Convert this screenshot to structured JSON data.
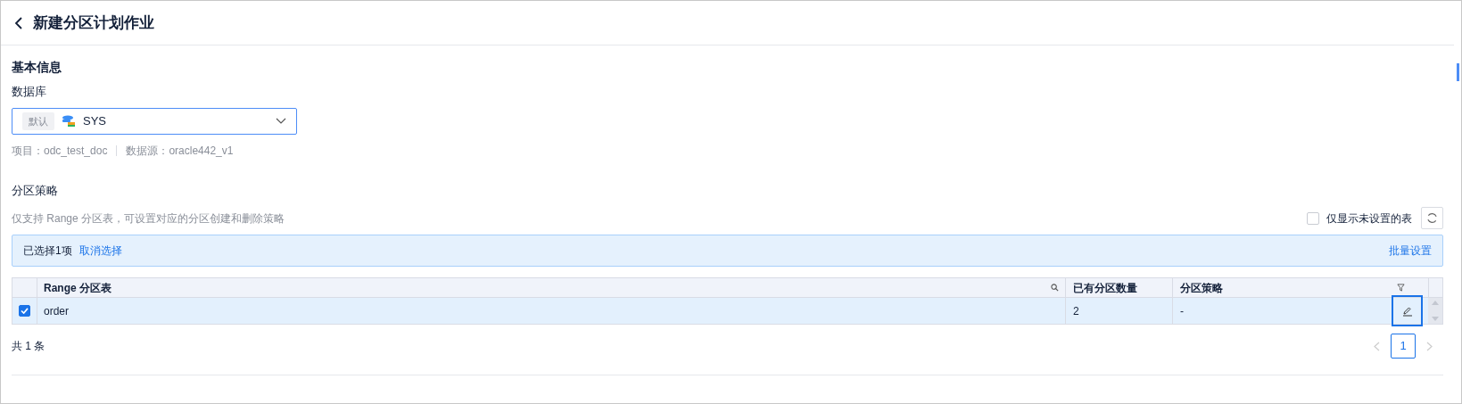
{
  "header": {
    "title": "新建分区计划作业"
  },
  "basic_info": {
    "heading": "基本信息",
    "database_label": "数据库",
    "database": {
      "tag": "默认",
      "value": "SYS"
    },
    "meta": [
      {
        "text": "项目：odc_test_doc"
      },
      {
        "text": "数据源：oracle442_v1"
      }
    ]
  },
  "partition_strategy": {
    "heading": "分区策略",
    "hint": "仅支持 Range 分区表，可设置对应的分区创建和删除策略",
    "only_unset": {
      "label": "仅显示未设置的表",
      "checked": false
    },
    "selection_bar": {
      "text": "已选择1项",
      "clear": "取消选择",
      "batch": "批量设置"
    },
    "table": {
      "columns": [
        "Range 分区表",
        "已有分区数量",
        "分区策略"
      ],
      "rows": [
        {
          "selected": true,
          "name": "order",
          "count": "2",
          "strategy": "-"
        }
      ]
    },
    "total": "共 1 条",
    "pages": [
      {
        "label": "1",
        "selected": true
      }
    ]
  }
}
